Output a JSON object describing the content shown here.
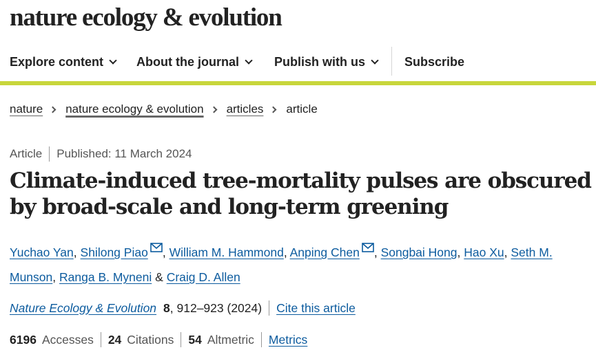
{
  "brand": {
    "name": "nature ecology & evolution"
  },
  "nav": {
    "items": [
      {
        "label": "Explore content"
      },
      {
        "label": "About the journal"
      },
      {
        "label": "Publish with us"
      }
    ],
    "subscribe": "Subscribe"
  },
  "colors": {
    "accent": "#c8d63b",
    "link": "#0c5b9e",
    "text": "#222222"
  },
  "breadcrumb": {
    "items": [
      "nature",
      "nature ecology & evolution",
      "articles"
    ],
    "current": "article"
  },
  "article": {
    "type": "Article",
    "published": "Published: 11 March 2024",
    "title": "Climate-induced tree-mortality pulses are obscured by broad-scale and long-term greening"
  },
  "authors": {
    "list": [
      "Yuchao Yan",
      "Shilong Piao",
      "William M. Hammond",
      "Anping Chen",
      "Songbai Hong",
      "Hao Xu",
      "Seth M. Munson",
      "Ranga B. Myneni",
      "Craig D. Allen"
    ],
    "separator": ",",
    "and": "&"
  },
  "citation": {
    "journal": "Nature Ecology & Evolution",
    "volume": "8",
    "pages": ", 912–923 (2024)",
    "cite": "Cite this article"
  },
  "metrics": {
    "accesses": {
      "value": "6196",
      "label": "Accesses"
    },
    "citations": {
      "value": "24",
      "label": "Citations"
    },
    "altmetric": {
      "value": "54",
      "label": "Altmetric"
    },
    "link": "Metrics"
  },
  "icons": {
    "chevron": "chevron-down-icon",
    "breadcrumb": "chevron-right-icon",
    "mail": "mail-icon"
  }
}
